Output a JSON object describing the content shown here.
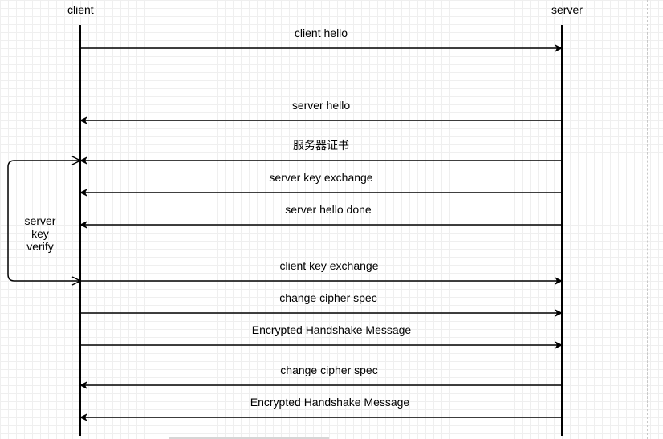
{
  "participants": {
    "client": "client",
    "server": "server"
  },
  "messages": [
    {
      "label": "client hello",
      "direction": "to-server"
    },
    {
      "label": "server hello",
      "direction": "to-client"
    },
    {
      "label": "服务器证书",
      "direction": "to-client"
    },
    {
      "label": "server key exchange",
      "direction": "to-client"
    },
    {
      "label": "server hello done",
      "direction": "to-client"
    },
    {
      "label": "client key exchange",
      "direction": "to-server"
    },
    {
      "label": "change cipher spec",
      "direction": "to-server"
    },
    {
      "label": "Encrypted Handshake Message",
      "direction": "to-server"
    },
    {
      "label": "change cipher spec",
      "direction": "to-client"
    },
    {
      "label": "Encrypted Handshake Message",
      "direction": "to-client"
    }
  ],
  "verify_loop": {
    "lines": [
      "server",
      "key",
      "verify"
    ]
  },
  "colors": {
    "line": "#000000",
    "grid": "#efefef",
    "background": "#ffffff"
  }
}
